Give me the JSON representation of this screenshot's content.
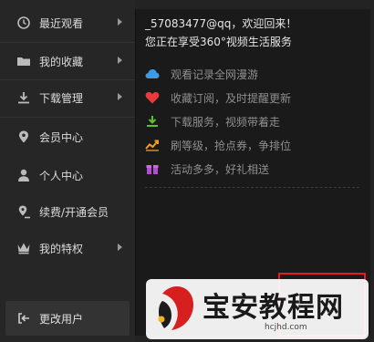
{
  "sidebar": {
    "items": [
      {
        "label": "最近观看",
        "icon": "history-icon",
        "has_arrow": true
      },
      {
        "label": "我的收藏",
        "icon": "folder-icon",
        "has_arrow": true
      },
      {
        "label": "下载管理",
        "icon": "download-icon",
        "has_arrow": true
      },
      {
        "label": "会员中心",
        "icon": "location-pin-icon",
        "has_arrow": false
      },
      {
        "label": "个人中心",
        "icon": "user-icon",
        "has_arrow": false
      },
      {
        "label": "续费/开通会员",
        "icon": "renew-pin-icon",
        "has_arrow": false
      },
      {
        "label": "我的特权",
        "icon": "crown-icon",
        "has_arrow": true
      }
    ],
    "change_user": {
      "label": "更改用户",
      "icon": "logout-icon"
    }
  },
  "panel": {
    "greeting_line1": "_57083477@qq，欢迎回来！",
    "greeting_line2": "您正在享受360°视频生活服务",
    "features": [
      {
        "text": "观看记录全网漫游",
        "icon": "cloud-icon",
        "color": "#3a9be8"
      },
      {
        "text": "收藏订阅，及时提醒更新",
        "icon": "heart-icon",
        "color": "#e83a3a"
      },
      {
        "text": "下载服务，视频带着走",
        "icon": "download-icon",
        "color": "#5cc12a"
      },
      {
        "text": "刷等级，抢点券，争排位",
        "icon": "trend-icon",
        "color": "#f0a020"
      },
      {
        "text": "活动多多，好礼相送",
        "icon": "gift-icon",
        "color": "#b04ed0"
      }
    ]
  },
  "watermark": {
    "title": "宝安教程网",
    "url": "hcjhd.com"
  }
}
